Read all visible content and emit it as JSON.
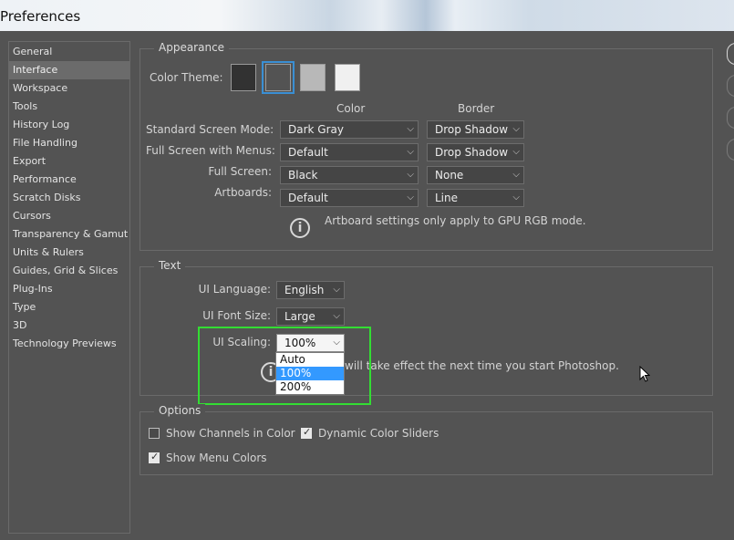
{
  "window": {
    "title": "Preferences"
  },
  "nav": {
    "items": [
      {
        "label": "General"
      },
      {
        "label": "Interface",
        "selected": true
      },
      {
        "label": "Workspace"
      },
      {
        "label": "Tools"
      },
      {
        "label": "History Log"
      },
      {
        "label": "File Handling"
      },
      {
        "label": "Export"
      },
      {
        "label": "Performance"
      },
      {
        "label": "Scratch Disks"
      },
      {
        "label": "Cursors"
      },
      {
        "label": "Transparency & Gamut"
      },
      {
        "label": "Units & Rulers"
      },
      {
        "label": "Guides, Grid & Slices"
      },
      {
        "label": "Plug-Ins"
      },
      {
        "label": "Type"
      },
      {
        "label": "3D"
      },
      {
        "label": "Technology Previews"
      }
    ]
  },
  "appearance": {
    "title": "Appearance",
    "color_theme_label": "Color Theme:",
    "theme_swatches": [
      "#323232",
      "#535353",
      "#b8b8b8",
      "#f0f0f0"
    ],
    "selected_theme_index": 1,
    "col_color": "Color",
    "col_border": "Border",
    "rows": [
      {
        "label": "Standard Screen Mode:",
        "color": "Dark Gray",
        "border": "Drop Shadow"
      },
      {
        "label": "Full Screen with Menus:",
        "color": "Default",
        "border": "Drop Shadow"
      },
      {
        "label": "Full Screen:",
        "color": "Black",
        "border": "None"
      },
      {
        "label": "Artboards:",
        "color": "Default",
        "border": "Line"
      }
    ],
    "info_text": "Artboard settings only apply to GPU RGB mode."
  },
  "text_group": {
    "title": "Text",
    "ui_language_label": "UI Language:",
    "ui_language_value": "English",
    "ui_font_size_label": "UI Font Size:",
    "ui_font_size_value": "Large",
    "ui_scaling_label": "UI Scaling:",
    "ui_scaling_value": "100%",
    "info_text": "will take effect the next time you start Photoshop.",
    "scaling_options": [
      "Auto",
      "100%",
      "200%"
    ],
    "scaling_highlighted": "100%"
  },
  "options": {
    "title": "Options",
    "show_channels_in_color": {
      "label": "Show Channels in Color",
      "checked": false
    },
    "dynamic_color_sliders": {
      "label": "Dynamic Color Sliders",
      "checked": true
    },
    "show_menu_colors": {
      "label": "Show Menu Colors",
      "checked": true
    }
  },
  "colors": {
    "panel_bg": "#535353",
    "highlight": "#33dd33",
    "selection": "#3399ff"
  }
}
